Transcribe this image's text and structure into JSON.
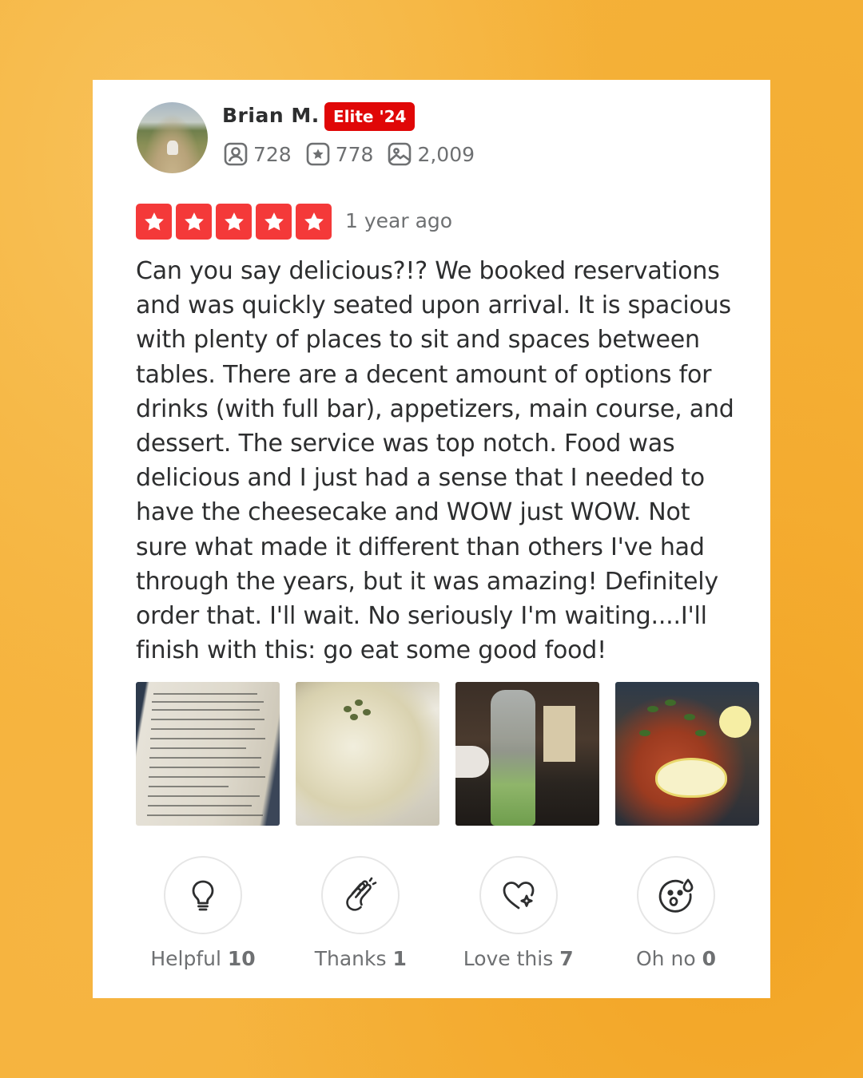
{
  "user": {
    "name": "Brian M.",
    "badge": "Elite '24",
    "stats": {
      "friends": "728",
      "reviews": "778",
      "photos": "2,009"
    }
  },
  "rating": {
    "stars": 5,
    "max_stars": 5,
    "date": "1 year ago",
    "color": "#f43939"
  },
  "review": {
    "text": "Can you say delicious?!? We booked reservations and was quickly seated upon arrival. It is spacious with plenty of places to sit and spaces between tables. There are a decent amount of options for drinks (with full bar), appetizers, main course, and dessert. The service was top notch. Food was delicious and I just had a sense that I needed to have the cheesecake and WOW just WOW. Not sure what made it different than others I've had through the years, but it was amazing! Definitely order that. I'll wait. No seriously I'm waiting....I'll finish with this: go eat some good food!"
  },
  "photos": [
    {
      "icon": "menu-photo"
    },
    {
      "icon": "pasta-photo"
    },
    {
      "icon": "drink-photo"
    },
    {
      "icon": "seafood-photo"
    }
  ],
  "reactions": [
    {
      "label": "Helpful",
      "count": "10",
      "icon": "lightbulb-icon"
    },
    {
      "label": "Thanks",
      "count": "1",
      "icon": "clapping-hands-icon"
    },
    {
      "label": "Love this",
      "count": "7",
      "icon": "heart-sparkle-icon"
    },
    {
      "label": "Oh no",
      "count": "0",
      "icon": "shocked-face-icon"
    }
  ],
  "colors": {
    "background": "#f5b23a",
    "elite_badge": "#e00707",
    "text": "#2d2e2f",
    "muted": "#6e7072"
  }
}
